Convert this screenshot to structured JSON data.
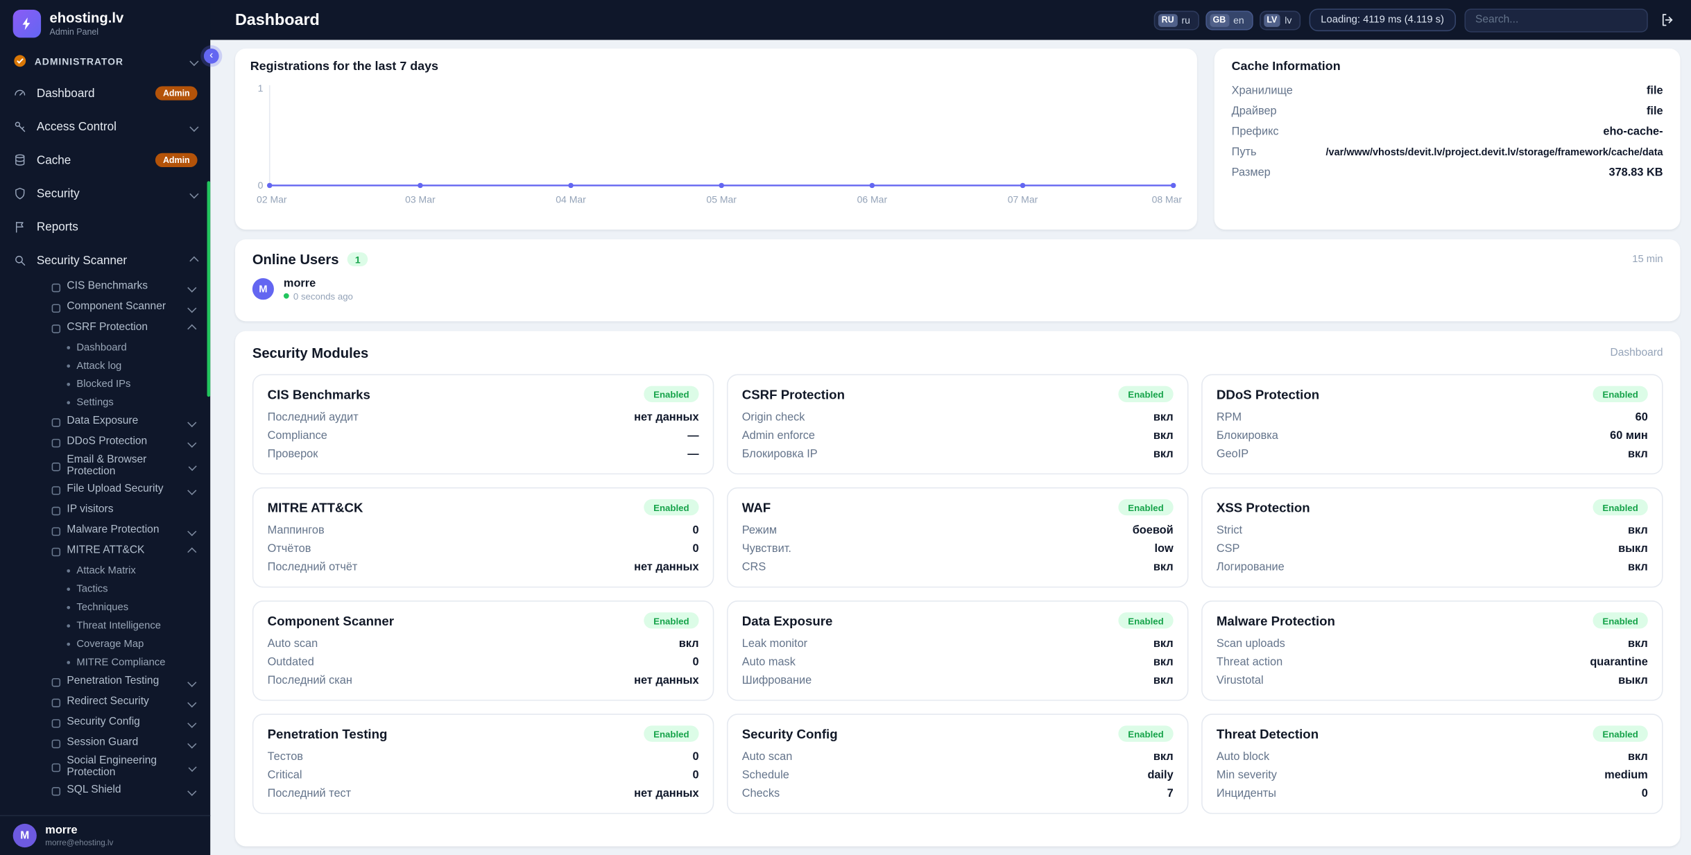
{
  "colors": {
    "accent": "#6366f1",
    "sidebar_bg": "#0f172a",
    "enabled_bg": "#dcfce7",
    "enabled_text": "#16a34a",
    "admin_badge_bg": "#b45309",
    "chart_line": "#6366f1",
    "online_dot": "#22c55e",
    "scrollbar": "#22c55e"
  },
  "header": {
    "title": "Dashboard",
    "languages": [
      {
        "code": "RU",
        "label": "ru",
        "active": false
      },
      {
        "code": "GB",
        "label": "en",
        "active": true
      },
      {
        "code": "LV",
        "label": "lv",
        "active": false
      }
    ],
    "loading_badge": "Loading: 4119 ms (4.119 s)",
    "search_placeholder": "Search..."
  },
  "sidebar": {
    "brand": {
      "name": "ehosting.lv",
      "subtitle": "Admin Panel"
    },
    "section": {
      "label": "ADMINISTRATOR"
    },
    "menu": [
      {
        "label": "Dashboard",
        "icon": "dashboard",
        "badge": "Admin"
      },
      {
        "label": "Access Control",
        "icon": "key",
        "chevron": "down"
      },
      {
        "label": "Cache",
        "icon": "database",
        "badge": "Admin"
      },
      {
        "label": "Security",
        "icon": "shield",
        "chevron": "down"
      },
      {
        "label": "Reports",
        "icon": "flag"
      },
      {
        "label": "Security Scanner",
        "icon": "magnifier",
        "chevron": "up",
        "children": [
          {
            "label": "CIS Benchmarks",
            "chevron": "down"
          },
          {
            "label": "Component Scanner",
            "chevron": "down"
          },
          {
            "label": "CSRF Protection",
            "chevron": "up",
            "children": [
              {
                "label": "Dashboard"
              },
              {
                "label": "Attack log"
              },
              {
                "label": "Blocked IPs"
              },
              {
                "label": "Settings"
              }
            ]
          },
          {
            "label": "Data Exposure",
            "chevron": "down"
          },
          {
            "label": "DDoS Protection",
            "chevron": "down"
          },
          {
            "label": "Email & Browser Protection",
            "chevron": "down"
          },
          {
            "label": "File Upload Security",
            "chevron": "down"
          },
          {
            "label": "IP visitors"
          },
          {
            "label": "Malware Protection",
            "chevron": "down"
          },
          {
            "label": "MITRE ATT&CK",
            "chevron": "up",
            "children": [
              {
                "label": "Attack Matrix"
              },
              {
                "label": "Tactics"
              },
              {
                "label": "Techniques"
              },
              {
                "label": "Threat Intelligence"
              },
              {
                "label": "Coverage Map"
              },
              {
                "label": "MITRE Compliance"
              }
            ]
          },
          {
            "label": "Penetration Testing",
            "chevron": "down"
          },
          {
            "label": "Redirect Security",
            "chevron": "down"
          },
          {
            "label": "Security Config",
            "chevron": "down"
          },
          {
            "label": "Session Guard",
            "chevron": "down"
          },
          {
            "label": "Social Engineering Protection",
            "chevron": "down"
          },
          {
            "label": "SQL Shield",
            "chevron": "down"
          }
        ]
      }
    ],
    "user": {
      "initial": "M",
      "name": "morre",
      "email": "morre@ehosting.lv"
    }
  },
  "chart_data": {
    "type": "line",
    "title": "Registrations for the last 7 days",
    "x": [
      "02 Mar",
      "03 Mar",
      "04 Mar",
      "05 Mar",
      "06 Mar",
      "07 Mar",
      "08 Mar"
    ],
    "values": [
      0,
      0,
      0,
      0,
      0,
      0,
      0
    ],
    "ylim": [
      0,
      1
    ],
    "yticks": [
      0,
      1
    ],
    "line_color": "#6366f1",
    "grid": false,
    "legend": "none"
  },
  "cache_card": {
    "title": "Cache Information",
    "rows": [
      {
        "label": "Хранилище",
        "value": "file"
      },
      {
        "label": "Драйвер",
        "value": "file"
      },
      {
        "label": "Префикс",
        "value": "eho-cache-"
      },
      {
        "label": "Путь",
        "value": "/var/www/vhosts/devit.lv/project.devit.lv/storage/framework/cache/data"
      },
      {
        "label": "Размер",
        "value": "378.83 KB"
      }
    ]
  },
  "online_card": {
    "title": "Online Users",
    "count": "1",
    "window_label": "15 min",
    "user": {
      "initial": "M",
      "name": "morre",
      "status": "0 seconds ago"
    }
  },
  "modules_card": {
    "title": "Security Modules",
    "link_label": "Dashboard",
    "enabled_label": "Enabled",
    "modules": [
      {
        "name": "CIS Benchmarks",
        "status": "Enabled",
        "stats": [
          {
            "label": "Последний аудит",
            "value": "нет данных"
          },
          {
            "label": "Compliance",
            "value": "—"
          },
          {
            "label": "Проверок",
            "value": "—"
          }
        ]
      },
      {
        "name": "CSRF Protection",
        "status": "Enabled",
        "stats": [
          {
            "label": "Origin check",
            "value": "вкл"
          },
          {
            "label": "Admin enforce",
            "value": "вкл"
          },
          {
            "label": "Блокировка IP",
            "value": "вкл"
          }
        ]
      },
      {
        "name": "DDoS Protection",
        "status": "Enabled",
        "stats": [
          {
            "label": "RPM",
            "value": "60"
          },
          {
            "label": "Блокировка",
            "value": "60 мин"
          },
          {
            "label": "GeoIP",
            "value": "вкл"
          }
        ]
      },
      {
        "name": "MITRE ATT&CK",
        "status": "Enabled",
        "stats": [
          {
            "label": "Маппингов",
            "value": "0"
          },
          {
            "label": "Отчётов",
            "value": "0"
          },
          {
            "label": "Последний отчёт",
            "value": "нет данных"
          }
        ]
      },
      {
        "name": "WAF",
        "status": "Enabled",
        "stats": [
          {
            "label": "Режим",
            "value": "боевой"
          },
          {
            "label": "Чувствит.",
            "value": "low"
          },
          {
            "label": "CRS",
            "value": "вкл"
          }
        ]
      },
      {
        "name": "XSS Protection",
        "status": "Enabled",
        "stats": [
          {
            "label": "Strict",
            "value": "вкл"
          },
          {
            "label": "CSP",
            "value": "выкл"
          },
          {
            "label": "Логирование",
            "value": "вкл"
          }
        ]
      },
      {
        "name": "Component Scanner",
        "status": "Enabled",
        "stats": [
          {
            "label": "Auto scan",
            "value": "вкл"
          },
          {
            "label": "Outdated",
            "value": "0"
          },
          {
            "label": "Последний скан",
            "value": "нет данных"
          }
        ]
      },
      {
        "name": "Data Exposure",
        "status": "Enabled",
        "stats": [
          {
            "label": "Leak monitor",
            "value": "вкл"
          },
          {
            "label": "Auto mask",
            "value": "вкл"
          },
          {
            "label": "Шифрование",
            "value": "вкл"
          }
        ]
      },
      {
        "name": "Malware Protection",
        "status": "Enabled",
        "stats": [
          {
            "label": "Scan uploads",
            "value": "вкл"
          },
          {
            "label": "Threat action",
            "value": "quarantine"
          },
          {
            "label": "Virustotal",
            "value": "выкл"
          }
        ]
      },
      {
        "name": "Penetration Testing",
        "status": "Enabled",
        "stats": [
          {
            "label": "Тестов",
            "value": "0"
          },
          {
            "label": "Critical",
            "value": "0"
          },
          {
            "label": "Последний тест",
            "value": "нет данных"
          }
        ]
      },
      {
        "name": "Security Config",
        "status": "Enabled",
        "stats": [
          {
            "label": "Auto scan",
            "value": "вкл"
          },
          {
            "label": "Schedule",
            "value": "daily"
          },
          {
            "label": "Checks",
            "value": "7"
          }
        ]
      },
      {
        "name": "Threat Detection",
        "status": "Enabled",
        "stats": [
          {
            "label": "Auto block",
            "value": "вкл"
          },
          {
            "label": "Min severity",
            "value": "medium"
          },
          {
            "label": "Инциденты",
            "value": "0"
          }
        ]
      }
    ]
  }
}
